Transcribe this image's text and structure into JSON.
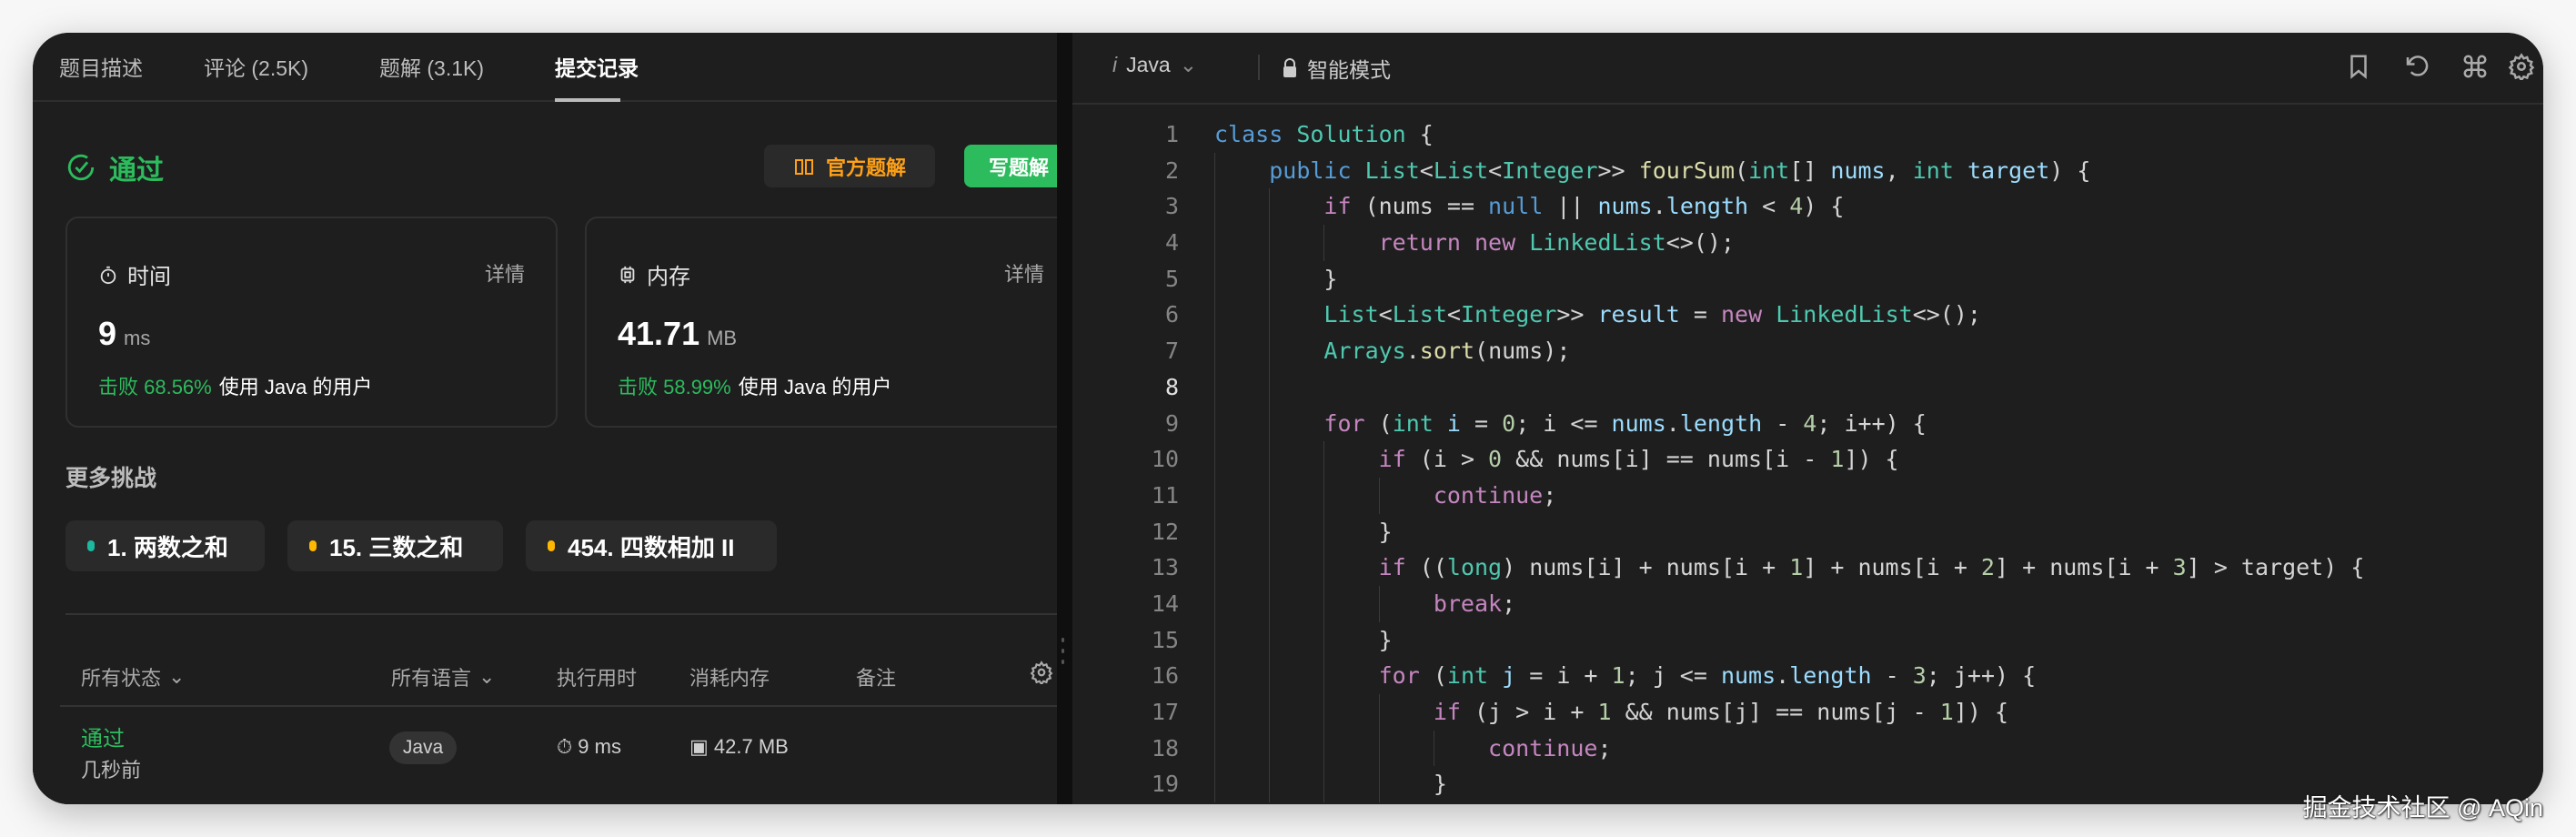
{
  "left": {
    "tabs": [
      "题目描述",
      "评论 (2.5K)",
      "题解 (3.1K)",
      "提交记录"
    ],
    "active_tab": 3,
    "status": "通过",
    "buttons": {
      "official": "官方题解",
      "write": "写题解"
    },
    "time_card": {
      "title": "时间",
      "detail": "详情",
      "value": "9",
      "unit": "ms",
      "beat_label": "击败 68.56%",
      "beat_suffix": "使用 Java 的用户"
    },
    "memory_card": {
      "title": "内存",
      "detail": "详情",
      "value": "41.71",
      "unit": "MB",
      "beat_label": "击败 58.99%",
      "beat_suffix": "使用 Java 的用户"
    },
    "more_title": "更多挑战",
    "challenges": [
      {
        "label": "1. 两数之和",
        "color": "#1cb8a0"
      },
      {
        "label": "15. 三数之和",
        "color": "#ffb800"
      },
      {
        "label": "454. 四数相加 II",
        "color": "#ffb800"
      }
    ],
    "table": {
      "headers": {
        "status": "所有状态",
        "language": "所有语言",
        "runtime": "执行用时",
        "memory": "消耗内存",
        "note": "备注"
      },
      "rows": [
        {
          "status": "通过",
          "time": "几秒前",
          "language": "Java",
          "runtime": "9 ms",
          "memory": "42.7 MB"
        }
      ]
    }
  },
  "editor": {
    "language": "Java",
    "mode": "智能模式",
    "current_line": 8,
    "lines": [
      [
        [
          "kw",
          "class "
        ],
        [
          "ty",
          "Solution"
        ],
        [
          "pl",
          " {"
        ]
      ],
      [
        [
          "pl",
          "    "
        ],
        [
          "kw",
          "public "
        ],
        [
          "ty",
          "List"
        ],
        [
          "pl",
          "<"
        ],
        [
          "ty",
          "List"
        ],
        [
          "pl",
          "<"
        ],
        [
          "ty",
          "Integer"
        ],
        [
          "pl",
          ">> "
        ],
        [
          "fn",
          "fourSum"
        ],
        [
          "pl",
          "("
        ],
        [
          "ty",
          "int"
        ],
        [
          "pl",
          "[] "
        ],
        [
          "var",
          "nums"
        ],
        [
          "pl",
          ", "
        ],
        [
          "ty",
          "int "
        ],
        [
          "var",
          "target"
        ],
        [
          "pl",
          ") {"
        ]
      ],
      [
        [
          "pl",
          "        "
        ],
        [
          "ctl",
          "if"
        ],
        [
          "pl",
          " (nums == "
        ],
        [
          "kw",
          "null"
        ],
        [
          "pl",
          " || "
        ],
        [
          "var",
          "nums"
        ],
        [
          "pl",
          "."
        ],
        [
          "var",
          "length"
        ],
        [
          "pl",
          " < "
        ],
        [
          "num",
          "4"
        ],
        [
          "pl",
          ") {"
        ]
      ],
      [
        [
          "pl",
          "            "
        ],
        [
          "ctl",
          "return new "
        ],
        [
          "ty",
          "LinkedList"
        ],
        [
          "pl",
          "<>();"
        ]
      ],
      [
        [
          "pl",
          "        }"
        ]
      ],
      [
        [
          "pl",
          "        "
        ],
        [
          "ty",
          "List"
        ],
        [
          "pl",
          "<"
        ],
        [
          "ty",
          "List"
        ],
        [
          "pl",
          "<"
        ],
        [
          "ty",
          "Integer"
        ],
        [
          "pl",
          ">> "
        ],
        [
          "var",
          "result"
        ],
        [
          "pl",
          " = "
        ],
        [
          "ctl",
          "new "
        ],
        [
          "ty",
          "LinkedList"
        ],
        [
          "pl",
          "<>();"
        ]
      ],
      [
        [
          "pl",
          "        "
        ],
        [
          "ty",
          "Arrays"
        ],
        [
          "pl",
          "."
        ],
        [
          "fn",
          "sort"
        ],
        [
          "pl",
          "(nums);"
        ]
      ],
      [
        [
          "pl",
          ""
        ]
      ],
      [
        [
          "pl",
          "        "
        ],
        [
          "ctl",
          "for"
        ],
        [
          "pl",
          " ("
        ],
        [
          "ty",
          "int "
        ],
        [
          "var",
          "i"
        ],
        [
          "pl",
          " = "
        ],
        [
          "num",
          "0"
        ],
        [
          "pl",
          "; i <= "
        ],
        [
          "var",
          "nums"
        ],
        [
          "pl",
          "."
        ],
        [
          "var",
          "length"
        ],
        [
          "pl",
          " - "
        ],
        [
          "num",
          "4"
        ],
        [
          "pl",
          "; i++) {"
        ]
      ],
      [
        [
          "pl",
          "            "
        ],
        [
          "ctl",
          "if"
        ],
        [
          "pl",
          " (i > "
        ],
        [
          "num",
          "0"
        ],
        [
          "pl",
          " && nums[i] == nums[i - "
        ],
        [
          "num",
          "1"
        ],
        [
          "pl",
          "]) {"
        ]
      ],
      [
        [
          "pl",
          "                "
        ],
        [
          "ctl",
          "continue"
        ],
        [
          "pl",
          ";"
        ]
      ],
      [
        [
          "pl",
          "            }"
        ]
      ],
      [
        [
          "pl",
          "            "
        ],
        [
          "ctl",
          "if"
        ],
        [
          "pl",
          " (("
        ],
        [
          "ty",
          "long"
        ],
        [
          "pl",
          ") nums[i] + nums[i + "
        ],
        [
          "num",
          "1"
        ],
        [
          "pl",
          "] + nums[i + "
        ],
        [
          "num",
          "2"
        ],
        [
          "pl",
          "] + nums[i + "
        ],
        [
          "num",
          "3"
        ],
        [
          "pl",
          "] > target) {"
        ]
      ],
      [
        [
          "pl",
          "                "
        ],
        [
          "ctl",
          "break"
        ],
        [
          "pl",
          ";"
        ]
      ],
      [
        [
          "pl",
          "            }"
        ]
      ],
      [
        [
          "pl",
          "            "
        ],
        [
          "ctl",
          "for"
        ],
        [
          "pl",
          " ("
        ],
        [
          "ty",
          "int "
        ],
        [
          "var",
          "j"
        ],
        [
          "pl",
          " = i + "
        ],
        [
          "num",
          "1"
        ],
        [
          "pl",
          "; j <= "
        ],
        [
          "var",
          "nums"
        ],
        [
          "pl",
          "."
        ],
        [
          "var",
          "length"
        ],
        [
          "pl",
          " - "
        ],
        [
          "num",
          "3"
        ],
        [
          "pl",
          "; j++) {"
        ]
      ],
      [
        [
          "pl",
          "                "
        ],
        [
          "ctl",
          "if"
        ],
        [
          "pl",
          " (j > i + "
        ],
        [
          "num",
          "1"
        ],
        [
          "pl",
          " && nums[j] == nums[j - "
        ],
        [
          "num",
          "1"
        ],
        [
          "pl",
          "]) {"
        ]
      ],
      [
        [
          "pl",
          "                    "
        ],
        [
          "ctl",
          "continue"
        ],
        [
          "pl",
          ";"
        ]
      ],
      [
        [
          "pl",
          "                }"
        ]
      ]
    ]
  },
  "watermark": "掘金技术社区 @ AQin",
  "colors": {
    "green": "#2cbb5d",
    "orange": "#ffa116",
    "bg": "#1e1e1e"
  }
}
